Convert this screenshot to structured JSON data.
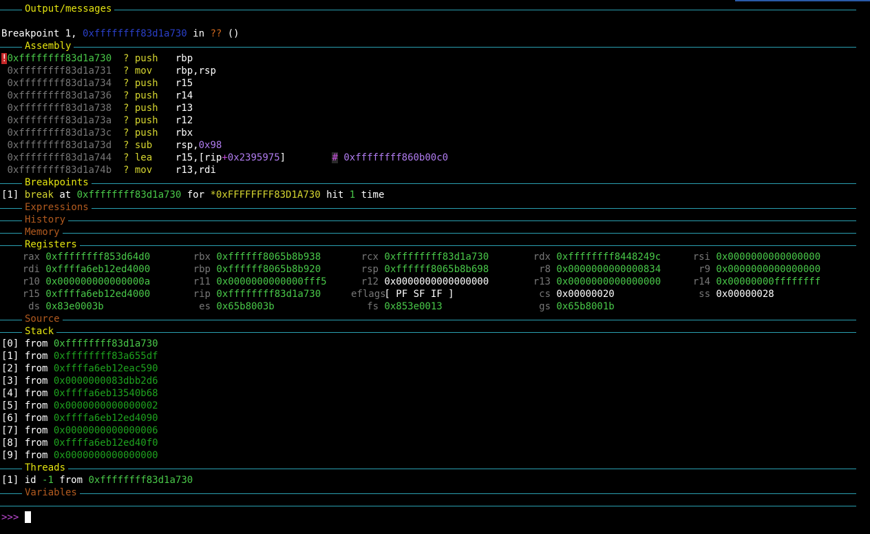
{
  "headers": {
    "output": "Output/messages",
    "assembly": "Assembly",
    "breakpoints": "Breakpoints",
    "expressions": "Expressions",
    "history": "History",
    "memory": "Memory",
    "registers": "Registers",
    "source": "Source",
    "stack": "Stack",
    "threads": "Threads",
    "variables": "Variables"
  },
  "output": {
    "prefix": "Breakpoint 1, ",
    "address": "0xffffffff83d1a730",
    "in": " in ",
    "func": "??",
    "suffix": " ()"
  },
  "assembly": {
    "current_marker": "!",
    "lines": [
      {
        "addr": "0xffffffff83d1a730",
        "q": "?",
        "op": "push",
        "args": "rbp"
      },
      {
        "addr": "0xffffffff83d1a731",
        "q": "?",
        "op": "mov",
        "args": "rbp,rsp"
      },
      {
        "addr": "0xffffffff83d1a734",
        "q": "?",
        "op": "push",
        "args": "r15"
      },
      {
        "addr": "0xffffffff83d1a736",
        "q": "?",
        "op": "push",
        "args": "r14"
      },
      {
        "addr": "0xffffffff83d1a738",
        "q": "?",
        "op": "push",
        "args": "r13"
      },
      {
        "addr": "0xffffffff83d1a73a",
        "q": "?",
        "op": "push",
        "args": "r12"
      },
      {
        "addr": "0xffffffff83d1a73c",
        "q": "?",
        "op": "push",
        "args": "rbx"
      },
      {
        "addr": "0xffffffff83d1a73d",
        "q": "?",
        "op": "sub",
        "args": "rsp,",
        "imm": "0x98"
      },
      {
        "addr": "0xffffffff83d1a744",
        "q": "?",
        "op": "lea",
        "args": "r15,[rip",
        "plus": "+",
        "off": "0x2395975",
        "close": "]",
        "comment_hash": "#",
        "comment": "0xffffffff860b00c0"
      },
      {
        "addr": "0xffffffff83d1a74b",
        "q": "?",
        "op": "mov",
        "args": "r13,rdi"
      }
    ]
  },
  "breakpoints": {
    "index": "[1]",
    "kind": "break",
    "at": " at ",
    "address": "0xffffffff83d1a730",
    "for": " for ",
    "expr": "*0xFFFFFFFF83D1A730",
    "hit": " hit ",
    "count": "1",
    "time": " time"
  },
  "registers": [
    {
      "name": "rax",
      "value": "0xffffffff853d64d0",
      "changed": true
    },
    {
      "name": "rbx",
      "value": "0xffffff8065b8b938",
      "changed": true
    },
    {
      "name": "rcx",
      "value": "0xffffffff83d1a730",
      "changed": true
    },
    {
      "name": "rdx",
      "value": "0xffffffff8448249c",
      "changed": true
    },
    {
      "name": "rsi",
      "value": "0x0000000000000000",
      "changed": true
    },
    {
      "name": "rdi",
      "value": "0xffffa6eb12ed4000",
      "changed": true
    },
    {
      "name": "rbp",
      "value": "0xffffff8065b8b920",
      "changed": true
    },
    {
      "name": "rsp",
      "value": "0xffffff8065b8b698",
      "changed": true
    },
    {
      "name": "r8",
      "value": "0x0000000000000834",
      "changed": true
    },
    {
      "name": "r9",
      "value": "0x0000000000000000",
      "changed": true
    },
    {
      "name": "r10",
      "value": "0x000000000000000a",
      "changed": true
    },
    {
      "name": "r11",
      "value": "0x0000000000000fff5",
      "changed": true
    },
    {
      "name": "r12",
      "value": "0x0000000000000000",
      "changed": false
    },
    {
      "name": "r13",
      "value": "0x0000000000000000",
      "changed": true
    },
    {
      "name": "r14",
      "value": "0x00000000ffffffff",
      "changed": true
    },
    {
      "name": "r15",
      "value": "0xffffa6eb12ed4000",
      "changed": true
    },
    {
      "name": "rip",
      "value": "0xffffffff83d1a730",
      "changed": true
    },
    {
      "name": "eflags",
      "value": "[ PF SF IF ]",
      "changed": false
    },
    {
      "name": "cs",
      "value": "0x00000020",
      "changed": false
    },
    {
      "name": "ss",
      "value": "0x00000028",
      "changed": false
    },
    {
      "name": "ds",
      "value": "0x83e0003b",
      "changed": true
    },
    {
      "name": "es",
      "value": "0x65b8003b",
      "changed": true
    },
    {
      "name": "fs",
      "value": "0x853e0013",
      "changed": true
    },
    {
      "name": "gs",
      "value": "0x65b8001b",
      "changed": true
    }
  ],
  "stack": {
    "frames": [
      {
        "index": "[0]",
        "from": "from",
        "addr": "0xffffffff83d1a730"
      },
      {
        "index": "[1]",
        "from": "from",
        "addr": "0xffffffff83a655df"
      },
      {
        "index": "[2]",
        "from": "from",
        "addr": "0xffffa6eb12eac590"
      },
      {
        "index": "[3]",
        "from": "from",
        "addr": "0x0000000083dbb2d6"
      },
      {
        "index": "[4]",
        "from": "from",
        "addr": "0xffffa6eb13540b68"
      },
      {
        "index": "[5]",
        "from": "from",
        "addr": "0x0000000000000002"
      },
      {
        "index": "[6]",
        "from": "from",
        "addr": "0xffffa6eb12ed4090"
      },
      {
        "index": "[7]",
        "from": "from",
        "addr": "0x0000000000000006"
      },
      {
        "index": "[8]",
        "from": "from",
        "addr": "0xffffa6eb12ed40f0"
      },
      {
        "index": "[9]",
        "from": "from",
        "addr": "0x0000000000000000"
      }
    ]
  },
  "threads": {
    "index": "[1]",
    "id": " id ",
    "id_value": "-1",
    "from": " from ",
    "addr": "0xffffffff83d1a730"
  },
  "prompt": ">>>"
}
